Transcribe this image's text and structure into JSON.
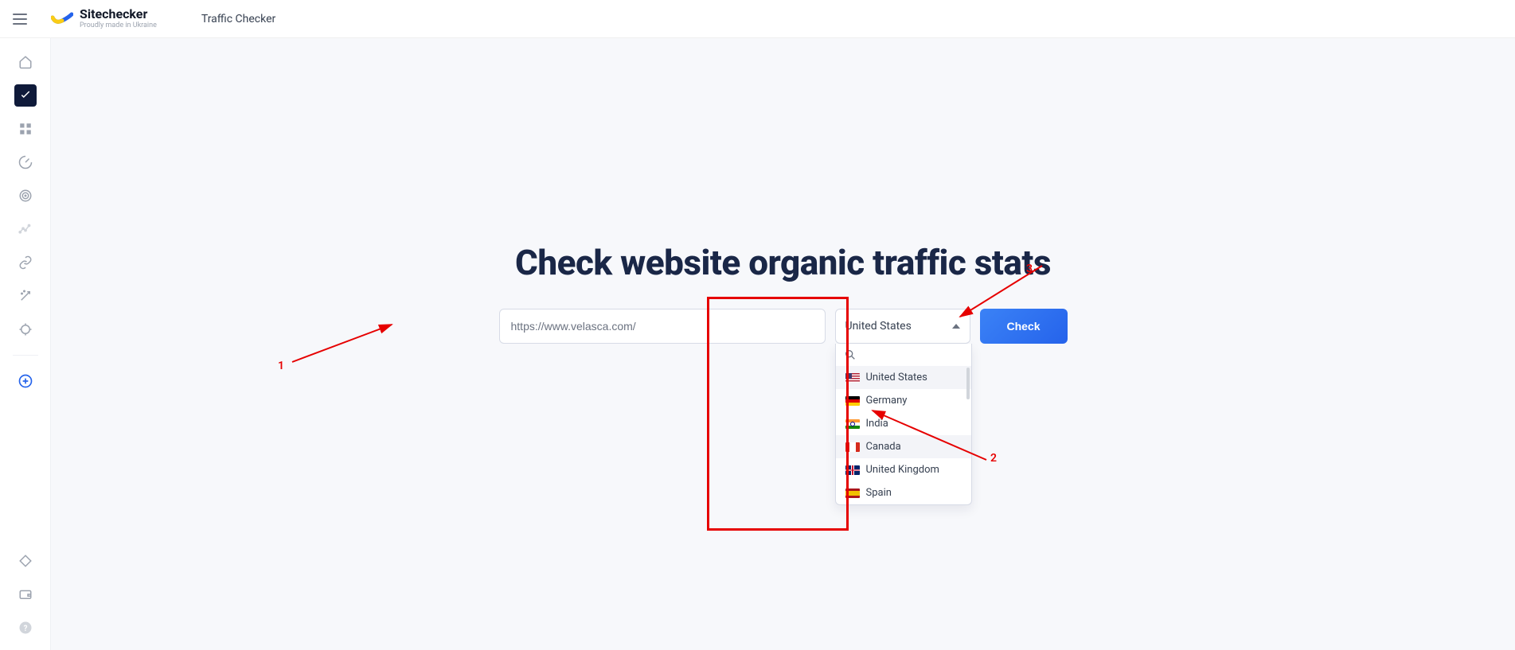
{
  "header": {
    "brand_name": "Sitechecker",
    "brand_sub": "Proudly made in Ukraine",
    "page_title": "Traffic Checker"
  },
  "hero": {
    "title": "Check website organic traffic stats",
    "url_value": "https://www.velasca.com/",
    "country_selected": "United States",
    "check_label": "Check"
  },
  "dropdown": {
    "options": [
      {
        "label": "United States",
        "flag": "us",
        "selected": true
      },
      {
        "label": "Germany",
        "flag": "de"
      },
      {
        "label": "India",
        "flag": "in"
      },
      {
        "label": "Canada",
        "flag": "ca",
        "hover": true
      },
      {
        "label": "United Kingdom",
        "flag": "uk"
      },
      {
        "label": "Spain",
        "flag": "es"
      }
    ]
  },
  "annotations": {
    "n1": "1",
    "n2": "2",
    "n3": "3"
  }
}
